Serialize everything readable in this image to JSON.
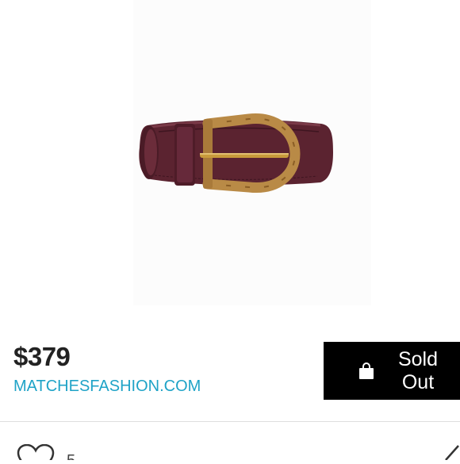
{
  "product": {
    "price": "$379",
    "retailer": "MATCHESFASHION.COM",
    "image_icon": "belt-product-photo",
    "colors": {
      "leather": "#5b2330",
      "bamboo": "#b98a46",
      "brass": "#c89b3c",
      "retailer_link": "#1fa3c7"
    }
  },
  "actions": {
    "sold_out_label": "Sold Out",
    "bag_icon": "shopping-bag-icon"
  },
  "social": {
    "likes": "5",
    "like_icon": "heart-icon",
    "share_icon": "share-arrow-icon"
  }
}
